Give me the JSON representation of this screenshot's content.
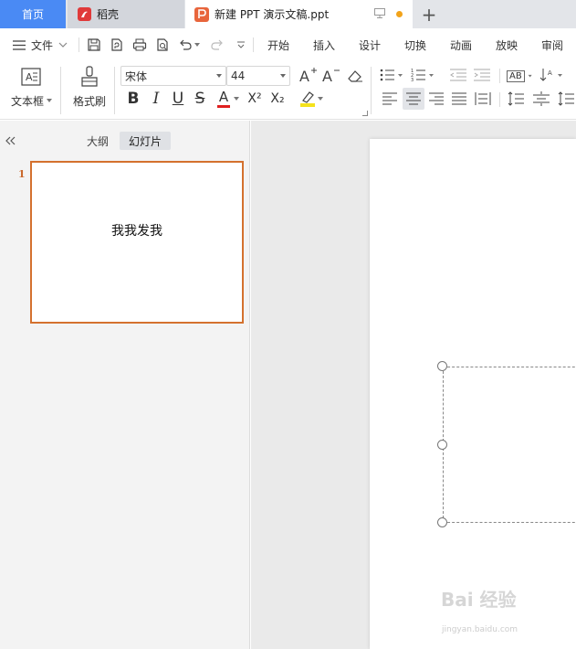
{
  "tabs": {
    "home": "首页",
    "shell": "稻壳",
    "doc": "新建 PPT 演示文稿.ppt",
    "add": "+"
  },
  "menubar": {
    "file": "文件",
    "items": [
      "开始",
      "插入",
      "设计",
      "切换",
      "动画",
      "放映",
      "审阅"
    ]
  },
  "ribbon": {
    "textbox_label": "文本框",
    "format_painter_label": "格式刷",
    "font_name": "宋体",
    "font_size": "44",
    "grow_font": "A⁺",
    "shrink_font": "A⁻",
    "bold": "B",
    "italic": "I",
    "underline": "U",
    "strike": "S",
    "font_color": "A",
    "superscript": "X²",
    "subscript": "X₂",
    "ab_label": "AB"
  },
  "panel": {
    "outline_tab": "大纲",
    "slides_tab": "幻灯片",
    "slide_number": "1",
    "slide_text": "我我发我"
  },
  "watermark": {
    "text": "Bai 经验",
    "url": "jingyan.baidu.com"
  },
  "colors": {
    "accent": "#4a8af4",
    "selected_border": "#d4712e",
    "font_color_underline": "#e02020",
    "highlight": "#f5e21b"
  }
}
